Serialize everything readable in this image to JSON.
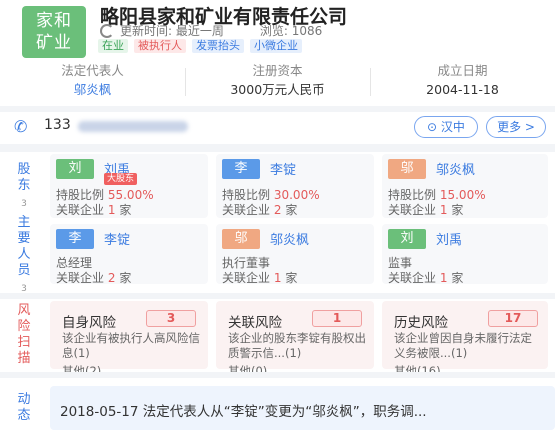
{
  "header": {
    "logo_line1": "家和",
    "logo_line2": "矿业",
    "company_name": "略阳县家和矿业有限责任公司",
    "update_text": "更新时间: 最近一周",
    "views_text": "浏览: 1086",
    "tags": [
      "在业",
      "被执行人",
      "发票抬头",
      "小微企业"
    ]
  },
  "info": {
    "legal_rep_label": "法定代表人",
    "legal_rep_value": "邬炎枫",
    "capital_label": "注册资本",
    "capital_value": "3000万元人民币",
    "founded_label": "成立日期",
    "founded_value": "2004-11-18"
  },
  "contact": {
    "phone_prefix": "133",
    "location_button": "汉中",
    "more_button": "更多 >"
  },
  "shareholders": {
    "label": "股东",
    "count": "3",
    "items": [
      {
        "avatar": "刘",
        "name": "刘禹",
        "badge": "大股东",
        "ratio_label": "持股比例",
        "ratio": "55.00%",
        "assoc_label": "关联企业",
        "assoc_count": "1",
        "assoc_unit": "家"
      },
      {
        "avatar": "李",
        "name": "李锭",
        "badge": "",
        "ratio_label": "持股比例",
        "ratio": "30.00%",
        "assoc_label": "关联企业",
        "assoc_count": "2",
        "assoc_unit": "家"
      },
      {
        "avatar": "邬",
        "name": "邬炎枫",
        "badge": "",
        "ratio_label": "持股比例",
        "ratio": "15.00%",
        "assoc_label": "关联企业",
        "assoc_count": "1",
        "assoc_unit": "家"
      }
    ]
  },
  "staff": {
    "label": "主要人员",
    "count": "3",
    "items": [
      {
        "avatar": "李",
        "name": "李锭",
        "role": "总经理",
        "assoc_label": "关联企业",
        "assoc_count": "2",
        "assoc_unit": "家"
      },
      {
        "avatar": "邬",
        "name": "邬炎枫",
        "role": "执行董事",
        "assoc_label": "关联企业",
        "assoc_count": "1",
        "assoc_unit": "家"
      },
      {
        "avatar": "刘",
        "name": "刘禹",
        "role": "监事",
        "assoc_label": "关联企业",
        "assoc_count": "1",
        "assoc_unit": "家"
      }
    ]
  },
  "risk": {
    "label": "风险扫描",
    "items": [
      {
        "title": "自身风险",
        "count": "3",
        "desc": "该企业有被执行人高风险信息(1)",
        "other": "其他(2)"
      },
      {
        "title": "关联风险",
        "count": "1",
        "desc": "该企业的股东李锭有股权出质警示信...(1)",
        "other": "其他(0)"
      },
      {
        "title": "历史风险",
        "count": "17",
        "desc": "该企业曾因自身未履行法定义务被限...(1)",
        "other": "其他(16)"
      }
    ]
  },
  "news": {
    "label": "动态",
    "text": "2018-05-17 法定代表人从“李锭”变更为“邬炎枫”，职务调..."
  },
  "colors": {
    "accent": "#3b7be0",
    "danger": "#e35a5a",
    "green": "#6bbf7a",
    "orange": "#f0a882"
  }
}
